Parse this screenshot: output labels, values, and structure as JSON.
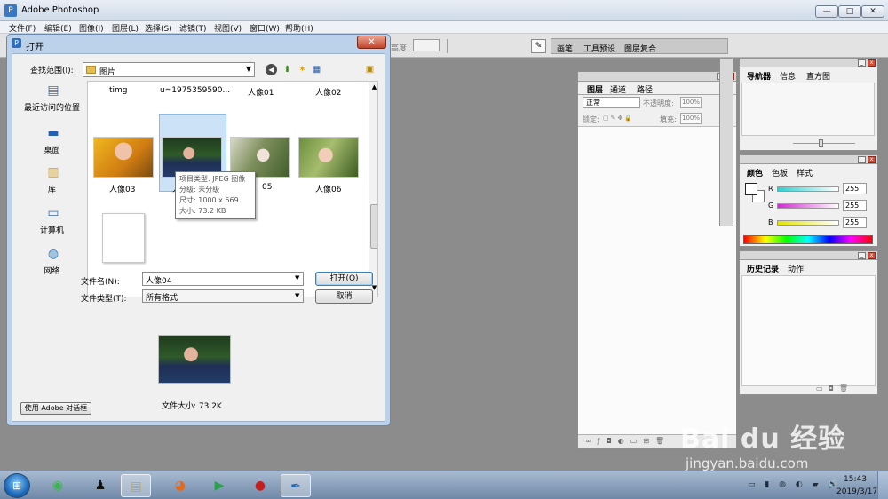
{
  "app": {
    "title": "Adobe Photoshop",
    "menu": [
      "文件(F)",
      "编辑(E)",
      "图像(I)",
      "图层(L)",
      "选择(S)",
      "滤镜(T)",
      "视图(V)",
      "窗口(W)",
      "帮助(H)"
    ],
    "window_buttons": {
      "minimize": "—",
      "maximize": "□",
      "close": "✕"
    }
  },
  "options_bar": {
    "height_label": "高度:",
    "brush_icon": "brush-icon",
    "palette_well_tabs": [
      "画笔",
      "工具预设",
      "图层复合"
    ]
  },
  "dialog": {
    "title": "打开",
    "close_label": "✕",
    "look_in_label": "查找范围(I):",
    "look_in_value": "图片",
    "places": [
      {
        "label": "最近访问的位置",
        "icon": "recent-places-icon"
      },
      {
        "label": "桌面",
        "icon": "desktop-icon"
      },
      {
        "label": "库",
        "icon": "libraries-icon"
      },
      {
        "label": "计算机",
        "icon": "computer-icon"
      },
      {
        "label": "网络",
        "icon": "network-icon"
      }
    ],
    "top_row_labels": [
      "timg",
      "u=1975359590...",
      "人像01",
      "人像02"
    ],
    "files": [
      {
        "label": "人像03",
        "photo": "yellow"
      },
      {
        "label": "人像04",
        "photo": "dark",
        "selected": true
      },
      {
        "label": "人像05",
        "photo": "garden"
      },
      {
        "label": "人像06",
        "photo": "green"
      }
    ],
    "visible_labels": {
      "file04_partial": "人",
      "file05_partial": "05"
    },
    "tooltip": [
      "项目类型: JPEG 图像",
      "分级: 未分级",
      "尺寸: 1000 x 669",
      "大小: 73.2 KB"
    ],
    "filename_label": "文件名(N):",
    "filename_value": "人像04",
    "filetype_label": "文件类型(T):",
    "filetype_value": "所有格式",
    "open_button": "打开(O)",
    "cancel_button": "取消",
    "file_size": "文件大小: 73.2K",
    "adobe_dialog_button": "使用 Adobe 对话框"
  },
  "layers_panel": {
    "tabs": [
      "图层",
      "通道",
      "路径"
    ],
    "blend_mode": "正常",
    "opacity_label": "不透明度:",
    "opacity_value": "100%",
    "lock_label": "锁定:",
    "fill_label": "填充:",
    "fill_value": "100%"
  },
  "navigator_panel": {
    "tabs": [
      "导航器",
      "信息",
      "直方图"
    ]
  },
  "color_panel": {
    "tabs": [
      "颜色",
      "色板",
      "样式"
    ],
    "channels": [
      {
        "label": "R",
        "value": "255",
        "color": "#2ad1d1"
      },
      {
        "label": "G",
        "value": "255",
        "color": "#d12ad1"
      },
      {
        "label": "B",
        "value": "255",
        "color": "#e4e400"
      }
    ]
  },
  "history_panel": {
    "tabs": [
      "历史记录",
      "动作"
    ]
  },
  "taskbar": {
    "time": "15:43",
    "date": "2019/3/17",
    "icons": [
      "start-orb",
      "360-browser-icon",
      "qq-icon",
      "file-explorer-icon",
      "firefox-icon",
      "video-player-icon",
      "screen-recorder-icon",
      "photoshop-icon"
    ]
  },
  "watermark": {
    "logo_text": "Bai du 经验",
    "url": "jingyan.baidu.com"
  }
}
